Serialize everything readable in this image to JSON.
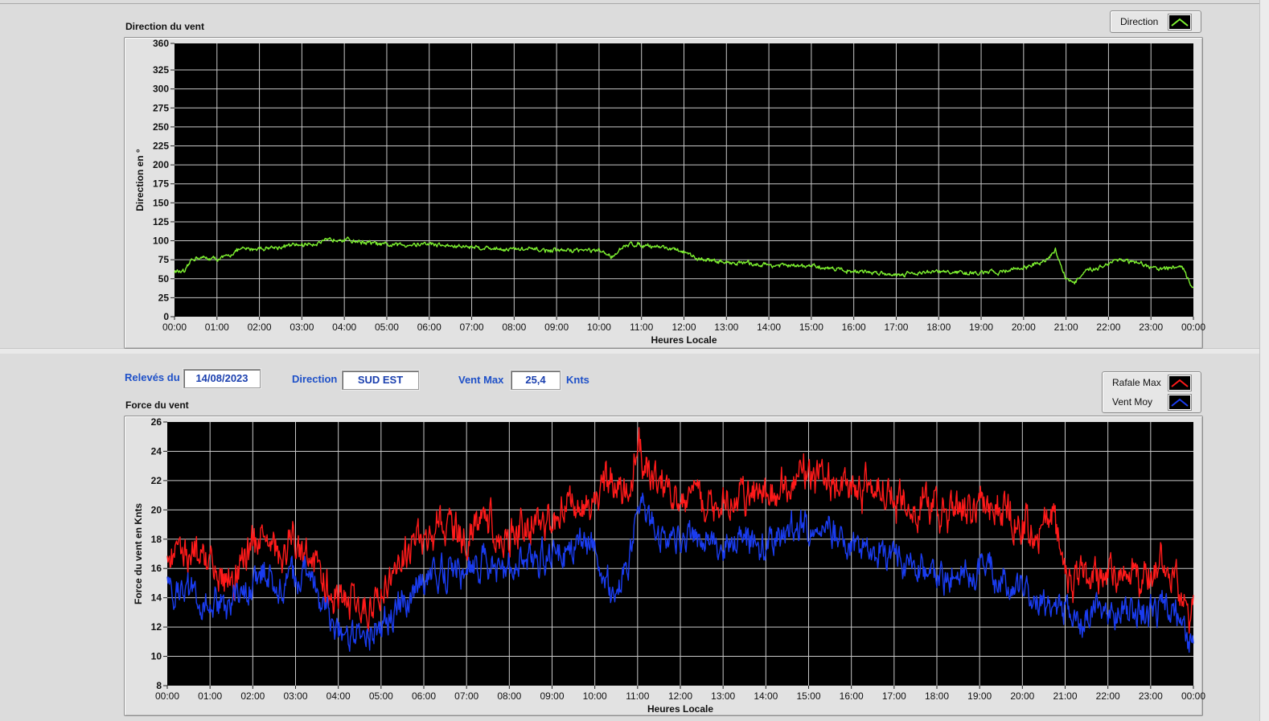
{
  "chart_data": [
    {
      "type": "line",
      "title": "Direction du vent",
      "xlabel": "Heures Locale",
      "ylabel": "Direction en °",
      "ylim": [
        0,
        360
      ],
      "yticks": [
        "0",
        "25",
        "50",
        "75",
        "100",
        "125",
        "150",
        "175",
        "200",
        "225",
        "250",
        "275",
        "300",
        "325",
        "360"
      ],
      "xticks": [
        "00:00",
        "01:00",
        "02:00",
        "03:00",
        "04:00",
        "05:00",
        "06:00",
        "07:00",
        "08:00",
        "09:00",
        "10:00",
        "11:00",
        "12:00",
        "13:00",
        "14:00",
        "15:00",
        "16:00",
        "17:00",
        "18:00",
        "19:00",
        "20:00",
        "21:00",
        "22:00",
        "23:00",
        "00:00"
      ],
      "grid": true,
      "legend_position": "top-right",
      "series": [
        {
          "name": "Direction",
          "color": "#7df030",
          "x_hours": [
            0,
            0.25,
            0.4,
            0.5,
            1,
            1.2,
            1.5,
            2,
            2.5,
            3,
            3.5,
            3.9,
            4,
            4.5,
            5,
            5.5,
            6,
            6.5,
            7,
            7.5,
            8,
            8.5,
            9,
            9.5,
            10,
            10.3,
            10.5,
            10.75,
            11,
            11.5,
            12,
            12.2,
            12.5,
            13,
            13.5,
            14,
            14.5,
            15,
            15.5,
            16,
            16.5,
            17,
            17.5,
            18,
            18.5,
            19,
            19.5,
            20,
            20.5,
            20.75,
            21,
            21.2,
            21.5,
            22,
            22.2,
            22.5,
            23,
            23.3,
            23.5,
            23.8,
            23.9,
            24
          ],
          "values": [
            60,
            58,
            75,
            78,
            76,
            78,
            88,
            90,
            92,
            95,
            98,
            104,
            102,
            98,
            94,
            95,
            96,
            93,
            92,
            90,
            89,
            88,
            87,
            88,
            86,
            80,
            88,
            96,
            95,
            92,
            85,
            78,
            75,
            72,
            70,
            68,
            67,
            66,
            64,
            60,
            58,
            56,
            58,
            59,
            58,
            57,
            60,
            65,
            72,
            88,
            50,
            45,
            60,
            70,
            76,
            72,
            65,
            62,
            66,
            62,
            45,
            40
          ]
        }
      ]
    },
    {
      "type": "line",
      "title": "Force du vent",
      "xlabel": "Heures Locale",
      "ylabel": "Force du vent en Knts",
      "ylim": [
        8,
        26
      ],
      "yticks": [
        "8",
        "10",
        "12",
        "14",
        "16",
        "18",
        "20",
        "22",
        "24",
        "26"
      ],
      "xticks": [
        "00:00",
        "01:00",
        "02:00",
        "03:00",
        "04:00",
        "05:00",
        "06:00",
        "07:00",
        "08:00",
        "09:00",
        "10:00",
        "11:00",
        "12:00",
        "13:00",
        "14:00",
        "15:00",
        "16:00",
        "17:00",
        "18:00",
        "19:00",
        "20:00",
        "21:00",
        "22:00",
        "23:00",
        "00:00"
      ],
      "grid": true,
      "legend_position": "top-right",
      "series": [
        {
          "name": "Rafale Max",
          "color": "#ff1a1a",
          "x_hours": [
            0,
            0.3,
            0.6,
            1,
            1.4,
            1.7,
            2,
            2.3,
            2.6,
            3,
            3.3,
            3.6,
            4,
            4.4,
            4.8,
            5,
            5.4,
            5.8,
            6,
            6.4,
            6.8,
            7,
            7.4,
            7.8,
            8,
            8.4,
            8.8,
            9,
            9.4,
            9.8,
            10,
            10.4,
            10.8,
            11,
            11.3,
            11.6,
            12,
            12.4,
            12.8,
            13,
            13.5,
            14,
            14.5,
            15,
            15.5,
            16,
            16.5,
            17,
            17.5,
            18,
            18.5,
            19,
            19.5,
            20,
            20.3,
            20.7,
            21,
            21.3,
            21.6,
            22,
            22.3,
            22.6,
            23,
            23.3,
            23.6,
            23.9,
            24
          ],
          "values": [
            17,
            17.5,
            17,
            16,
            15,
            16,
            17.5,
            19,
            17,
            17.5,
            17,
            15.5,
            14,
            13.5,
            13,
            14.5,
            16,
            18,
            17.5,
            19,
            18.5,
            18,
            19.5,
            18,
            18,
            19,
            19.5,
            19.5,
            20.5,
            20,
            21,
            22,
            20.5,
            24.5,
            22.5,
            21.5,
            21,
            21,
            20.5,
            20.5,
            21,
            21,
            22,
            22.5,
            21.5,
            21.5,
            22,
            21,
            20.5,
            20,
            20,
            20.5,
            20,
            19.5,
            18.5,
            19.5,
            16,
            15,
            15.5,
            16.5,
            15.5,
            16,
            15.5,
            16.5,
            16,
            12.5,
            14
          ]
        },
        {
          "name": "Vent Moy",
          "color": "#1a3cf0",
          "x_hours": [
            0,
            0.3,
            0.6,
            1,
            1.4,
            1.7,
            2,
            2.3,
            2.6,
            3,
            3.3,
            3.6,
            4,
            4.4,
            4.8,
            5,
            5.4,
            5.8,
            6,
            6.4,
            6.8,
            7,
            7.4,
            7.8,
            8,
            8.4,
            8.8,
            9,
            9.4,
            9.8,
            10,
            10.4,
            10.8,
            11,
            11.3,
            11.6,
            12,
            12.4,
            12.8,
            13,
            13.5,
            14,
            14.5,
            15,
            15.5,
            16,
            16.5,
            17,
            17.5,
            18,
            18.5,
            19,
            19.5,
            20,
            20.3,
            20.7,
            21,
            21.3,
            21.6,
            22,
            22.3,
            22.6,
            23,
            23.3,
            23.6,
            23.9,
            24
          ],
          "values": [
            15,
            14.5,
            14,
            13.5,
            13.5,
            14,
            15,
            16,
            15,
            15.5,
            15.5,
            13.5,
            12,
            11.5,
            11.5,
            12,
            13.5,
            15,
            15,
            16,
            16,
            16,
            16.5,
            16,
            16,
            16.5,
            17,
            17,
            17.5,
            17.5,
            17.5,
            14,
            16,
            20,
            19,
            18,
            18,
            18,
            17.5,
            17.5,
            18,
            17.5,
            18.5,
            19,
            18.5,
            17.5,
            17.5,
            17,
            16,
            15.5,
            15.5,
            16,
            15.5,
            15,
            13.5,
            13.5,
            13.5,
            12.5,
            13,
            13.5,
            13,
            13,
            13,
            13.5,
            13,
            10.5,
            11.5
          ]
        }
      ]
    }
  ],
  "info": {
    "date_label": "Relevés du",
    "date_value": "14/08/2023",
    "direction_label": "Direction",
    "direction_value": "SUD EST",
    "ventmax_label": "Vent Max",
    "ventmax_value": "25,4",
    "ventmax_unit": "Knts"
  },
  "colors": {
    "plot_background": "#000000",
    "grid": "#c8c8c8",
    "info_text": "#1e50c8"
  }
}
